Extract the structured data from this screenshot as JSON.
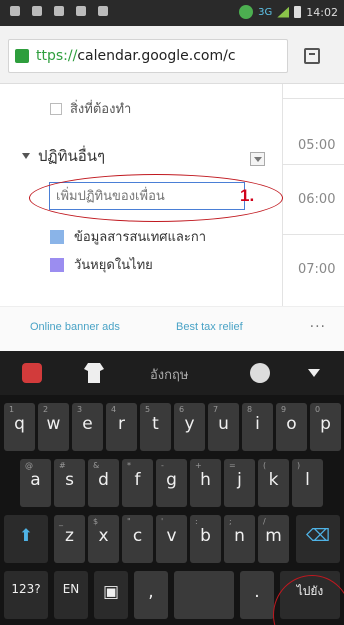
{
  "status_bar": {
    "network": "3G",
    "time": "14:02"
  },
  "browser": {
    "url_scheme": "ttps://",
    "url_rest": "calendar.google.com/c"
  },
  "calendar": {
    "todo_label": "สิ่งที่ต้องทำ",
    "other_calendars_title": "ปฏิทินอื่นๆ",
    "add_friend_placeholder": "เพิ่มปฏิทินของเพื่อน",
    "annotation_number": "1.",
    "items": [
      {
        "label": "ข้อมูลสารสนเทศและกา",
        "color": "#8ab4e8"
      },
      {
        "label": "วันหยุดในไทย",
        "color": "#9b8df0"
      }
    ],
    "times": [
      "05:00",
      "06:00",
      "07:00"
    ]
  },
  "ads": {
    "link1": "Online banner ads",
    "link2": "Best tax relief",
    "more": "···"
  },
  "keyboard": {
    "language": "อังกฤษ",
    "row1": [
      {
        "k": "q",
        "h": "1"
      },
      {
        "k": "w",
        "h": "2"
      },
      {
        "k": "e",
        "h": "3"
      },
      {
        "k": "r",
        "h": "4"
      },
      {
        "k": "t",
        "h": "5"
      },
      {
        "k": "y",
        "h": "6"
      },
      {
        "k": "u",
        "h": "7"
      },
      {
        "k": "i",
        "h": "8"
      },
      {
        "k": "o",
        "h": "9"
      },
      {
        "k": "p",
        "h": "0"
      }
    ],
    "row2": [
      {
        "k": "a",
        "h": "@"
      },
      {
        "k": "s",
        "h": "#"
      },
      {
        "k": "d",
        "h": "&"
      },
      {
        "k": "f",
        "h": "*"
      },
      {
        "k": "g",
        "h": "-"
      },
      {
        "k": "h",
        "h": "+"
      },
      {
        "k": "j",
        "h": "="
      },
      {
        "k": "k",
        "h": "("
      },
      {
        "k": "l",
        "h": ")"
      }
    ],
    "row3": [
      {
        "k": "z",
        "h": "_"
      },
      {
        "k": "x",
        "h": "$"
      },
      {
        "k": "c",
        "h": "\""
      },
      {
        "k": "v",
        "h": "'"
      },
      {
        "k": "b",
        "h": ":"
      },
      {
        "k": "n",
        "h": ";"
      },
      {
        "k": "m",
        "h": "/"
      }
    ],
    "num_key": "123?",
    "lang_key": "EN",
    "comma_key": ",",
    "period_key": ".",
    "go_key": "ไปยัง"
  },
  "colors": {
    "accent": "#4a7fd6",
    "annotation": "#c0181f"
  }
}
